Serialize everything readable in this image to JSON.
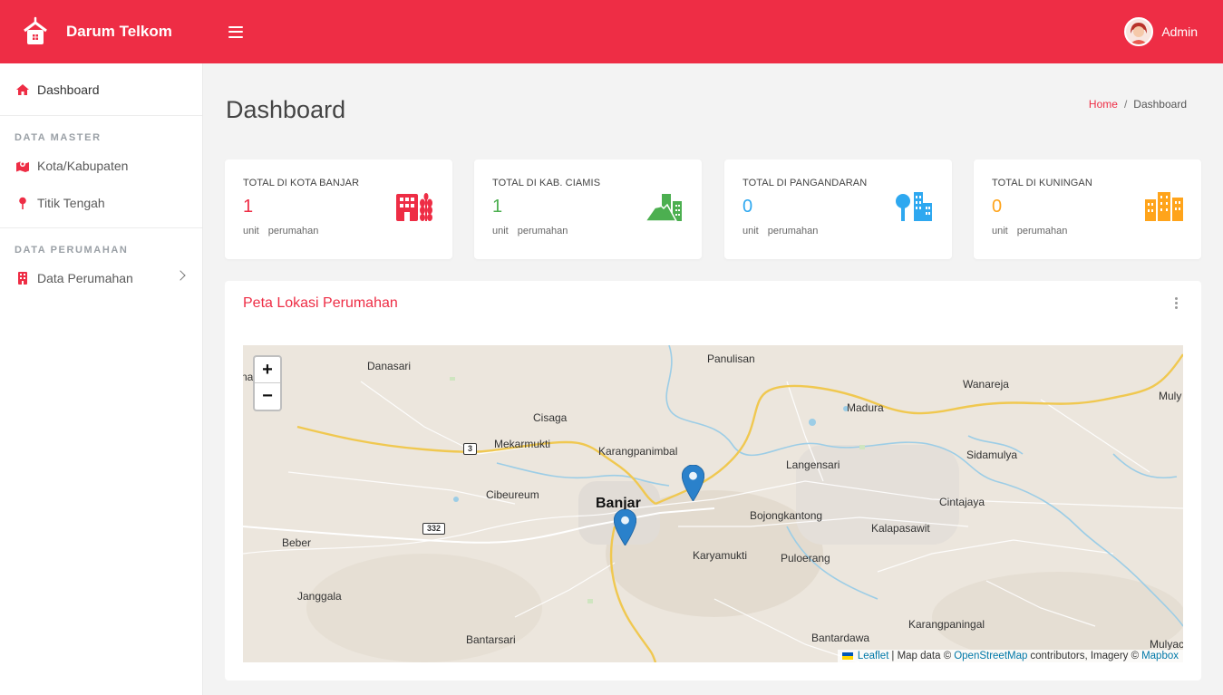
{
  "app": {
    "brand": "Darum Telkom",
    "accent": "#ee2d45"
  },
  "user": {
    "name": "Admin"
  },
  "sidebar": {
    "dashboard": "Dashboard",
    "section_master": "DATA MASTER",
    "kota": "Kota/Kabupaten",
    "titik": "Titik Tengah",
    "section_perumahan": "DATA PERUMAHAN",
    "perumahan": "Data Perumahan"
  },
  "page": {
    "title": "Dashboard"
  },
  "breadcrumb": {
    "home": "Home",
    "sep": "/",
    "current": "Dashboard"
  },
  "stats": [
    {
      "label": "TOTAL DI KOTA BANJAR",
      "value": "1",
      "unit": "unit",
      "desc": "perumahan",
      "color": "#ee2d45",
      "icon": "city-icon"
    },
    {
      "label": "TOTAL DI KAB. CIAMIS",
      "value": "1",
      "unit": "unit",
      "desc": "perumahan",
      "color": "#4caf50",
      "icon": "mountain-city-icon"
    },
    {
      "label": "TOTAL DI PANGANDARAN",
      "value": "0",
      "unit": "unit",
      "desc": "perumahan",
      "color": "#2ea8f0",
      "icon": "tree-city-icon"
    },
    {
      "label": "TOTAL DI KUNINGAN",
      "value": "0",
      "unit": "unit",
      "desc": "perumahan",
      "color": "#ffa41b",
      "icon": "building-icon"
    }
  ],
  "map": {
    "title": "Peta Lokasi Perumahan",
    "zoom_in": "+",
    "zoom_out": "−",
    "places": {
      "danasari": "Danasari",
      "panulisan": "Panulisan",
      "wanareja": "Wanareja",
      "madura": "Madura",
      "muly": "Muly",
      "cisaga": "Cisaga",
      "mekarmukti": "Mekarmukti",
      "karangpanimbal": "Karangpanimbal",
      "sidamulya": "Sidamulya",
      "langensari": "Langensari",
      "cibeureum": "Cibeureum",
      "banjar": "Banjar",
      "cintajaya": "Cintajaya",
      "bojongkantong": "Bojongkantong",
      "kalapasawit": "Kalapasawit",
      "beber": "Beber",
      "karyamukti": "Karyamukti",
      "puloerang": "Puloerang",
      "janggala": "Janggala",
      "bantarsari": "Bantarsari",
      "bantardawa": "Bantardawa",
      "karangpaningal": "Karangpaningal",
      "mulyac": "Mulyac",
      "na": "na"
    },
    "shields": {
      "r3": "3",
      "r332": "332"
    },
    "attribution": {
      "leaflet": "Leaflet",
      "map_data": "| Map data ©",
      "osm": "OpenStreetMap",
      "contrib": "contributors, Imagery ©",
      "mapbox": "Mapbox"
    }
  }
}
